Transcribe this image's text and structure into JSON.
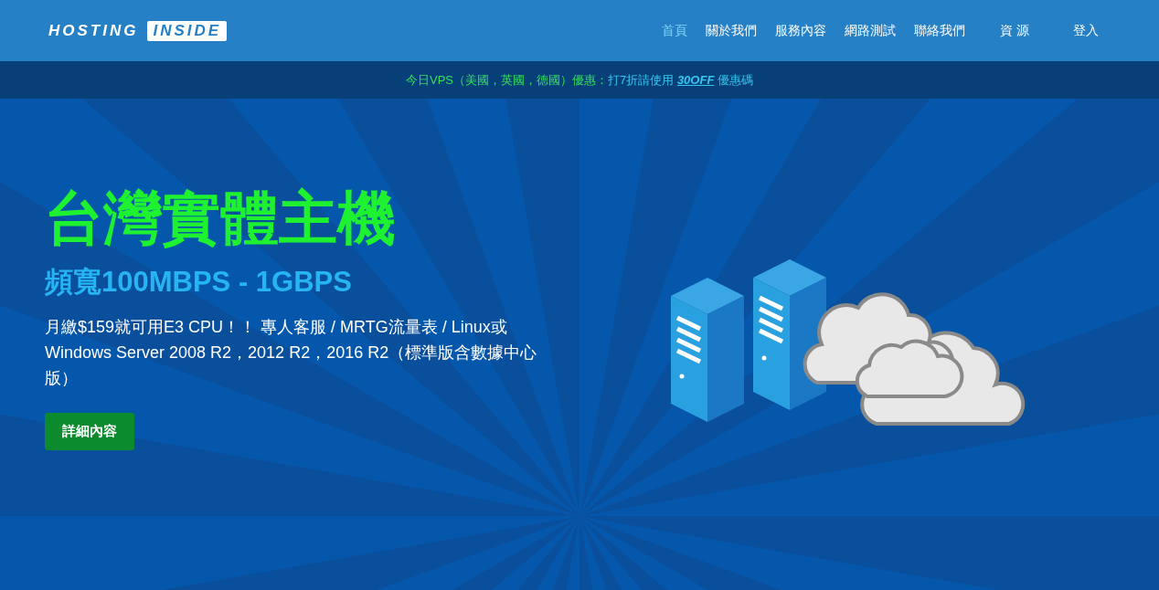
{
  "logo": {
    "word_1": "HOSTING",
    "word_2": "INSIDE"
  },
  "nav": [
    {
      "label": "首頁",
      "selected": true
    },
    {
      "label": "關於我們",
      "selected": false
    },
    {
      "label": "服務內容",
      "selected": false
    },
    {
      "label": "網路測試",
      "selected": false
    },
    {
      "label": "聯絡我們",
      "selected": false
    },
    {
      "label": "資 源",
      "selected": false
    },
    {
      "label": "登入",
      "selected": false
    }
  ],
  "promo": {
    "lead": "今日VPS（美國，英國，德國）優惠：",
    "offer": "打7折請使用 ",
    "code": "30OFF",
    "tail": " 優惠碼"
  },
  "hero": {
    "title": "台灣實體主機",
    "subtitle": "頻寬100MBPS - 1GBPS",
    "description": "月繳$159就可用E3 CPU！！ 專人客服 / MRTG流量表 / Linux或Windows Server 2008 R2，2012 R2，2016 R2（標準版含數據中心版）",
    "button": "詳細內容"
  }
}
